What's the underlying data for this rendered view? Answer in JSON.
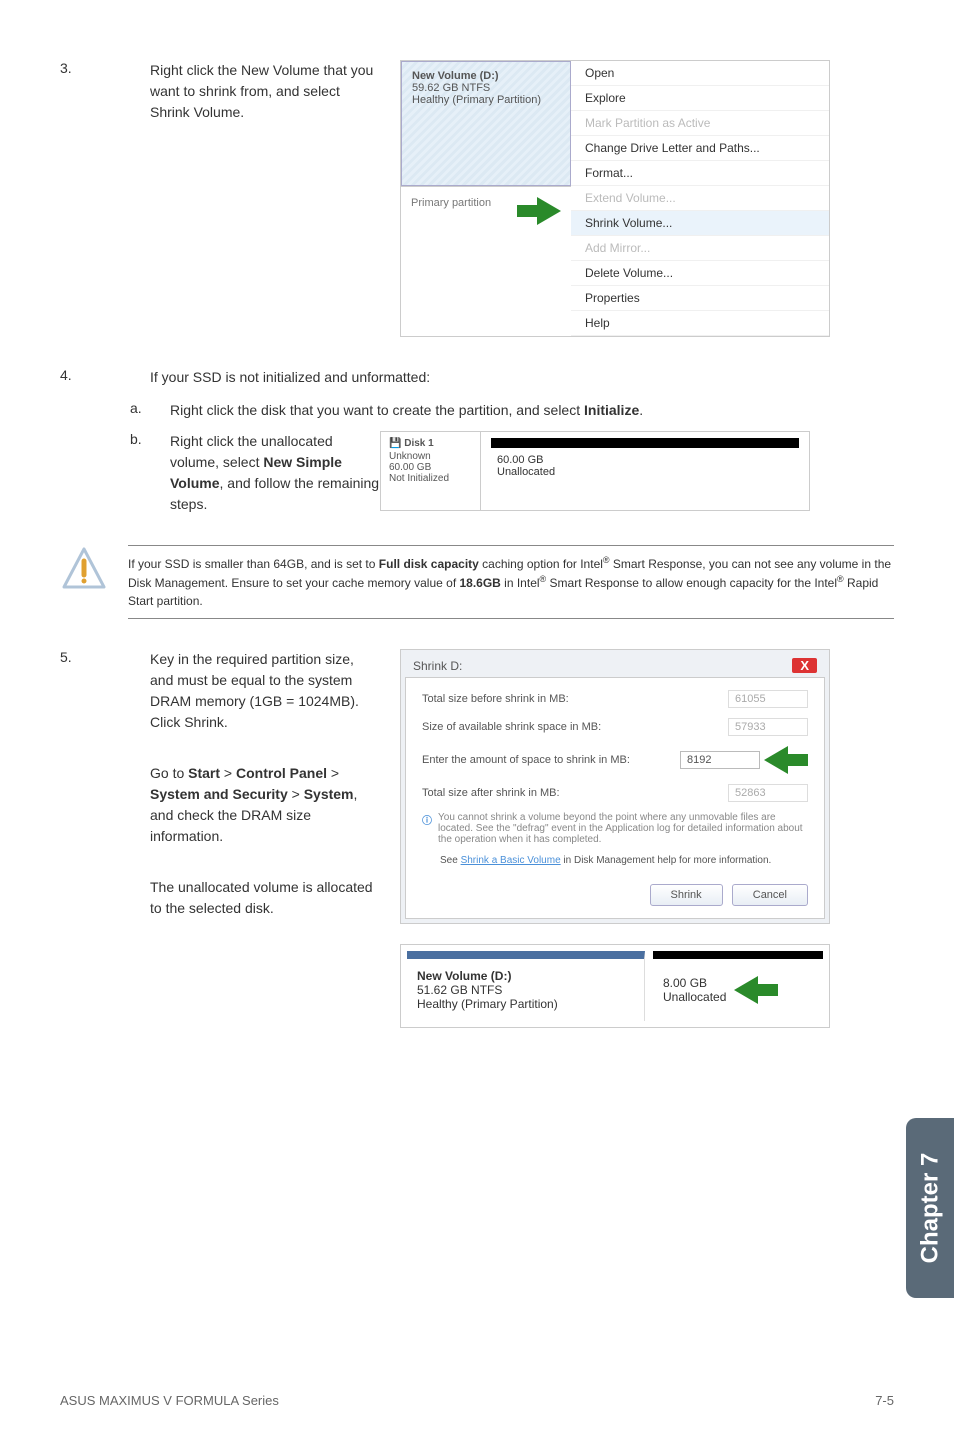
{
  "step3": {
    "num": "3.",
    "text": "Right click the New Volume that you want to shrink from, and select Shrink Volume."
  },
  "img1": {
    "volume_title": "New Volume (D:)",
    "volume_size": "59.62 GB NTFS",
    "volume_status": "Healthy (Primary Partition)",
    "primary": "Primary partition",
    "menu": {
      "open": "Open",
      "explore": "Explore",
      "mark": "Mark Partition as Active",
      "change": "Change Drive Letter and Paths...",
      "format": "Format...",
      "extend": "Extend Volume...",
      "shrink": "Shrink Volume...",
      "addmirror": "Add Mirror...",
      "delete": "Delete Volume...",
      "properties": "Properties",
      "help": "Help"
    }
  },
  "step4": {
    "num": "4.",
    "text": "If your SSD is not initialized and unformatted:",
    "a_letter": "a.",
    "a_text_1": "Right click the disk that you want to create the partition, and select ",
    "a_text_2": "Initialize",
    "a_text_3": ".",
    "b_letter": "b.",
    "b_text_1": "Right click the unallocated volume, select ",
    "b_text_2": "New Simple Volume",
    "b_text_3": ", and follow the remaining steps."
  },
  "img2": {
    "disk_label": "Disk 1",
    "unknown": "Unknown",
    "size_left": "60.00 GB",
    "notinit": "Not Initialized",
    "size_right": "60.00 GB",
    "unalloc": "Unallocated"
  },
  "note": {
    "t1": "If your SSD is smaller than 64GB, and is set to ",
    "t2": "Full disk capacity",
    "t3": " caching option for Intel",
    "t4": " Smart Response, you can not see any volume in the Disk Management. Ensure to set your cache memory value of ",
    "t5": "18.6GB",
    "t6": " in Intel",
    "t7": " Smart Response to allow enough capacity for the Intel",
    "t8": " Rapid Start partition."
  },
  "step5": {
    "num": "5.",
    "text": "Key in the required partition size, and must be equal to the system DRAM memory (1GB = 1024MB). Click Shrink.",
    "goto_1": "Go to ",
    "goto_2": "Start",
    "goto_3": " > ",
    "goto_4": "Control Panel",
    "goto_5": " > ",
    "goto_6": "System and Security",
    "goto_7": " > ",
    "goto_8": "System",
    "goto_9": ", and check the DRAM size information.",
    "unalloc": "The unallocated volume is allocated to the selected disk."
  },
  "img3": {
    "title": "Shrink D:",
    "close": "X",
    "row1_label": "Total size before shrink in MB:",
    "row1_val": "61055",
    "row2_label": "Size of available shrink space in MB:",
    "row2_val": "57933",
    "row3_label": "Enter the amount of space to shrink in MB:",
    "row3_val": "8192",
    "row4_label": "Total size after shrink in MB:",
    "row4_val": "52863",
    "info_text": "You cannot shrink a volume beyond the point where any unmovable files are located. See the \"defrag\" event in the Application log for detailed information about the operation when it has completed.",
    "link_1": "See ",
    "link_2": "Shrink a Basic Volume",
    "link_3": " in Disk Management help for more information.",
    "btn_shrink": "Shrink",
    "btn_cancel": "Cancel"
  },
  "img4": {
    "vol_title": "New Volume (D:)",
    "vol_size": "51.62 GB NTFS",
    "vol_status": "Healthy (Primary Partition)",
    "right_size": "8.00 GB",
    "right_unalloc": "Unallocated"
  },
  "chapter": "Chapter 7",
  "footer_left": "ASUS MAXIMUS V FORMULA Series",
  "footer_right": "7-5",
  "reg": "®"
}
